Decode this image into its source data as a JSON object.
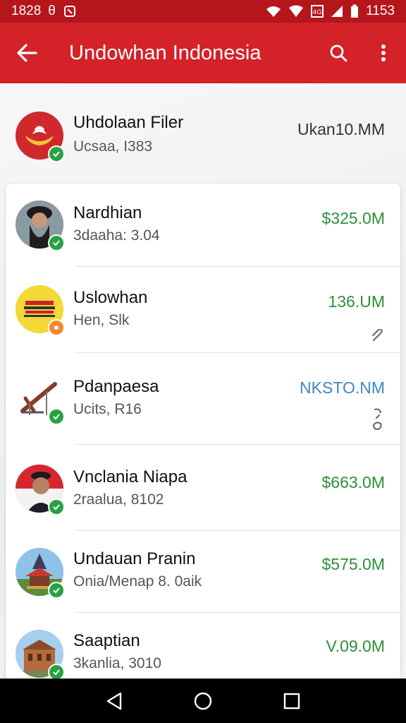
{
  "status_bar": {
    "time_left": "1828",
    "glyph_b": "θ",
    "time_right": "1153"
  },
  "app_bar": {
    "title": "Undowhan Indonesia"
  },
  "header_item": {
    "name": "Uhdolaan Filer",
    "sub": "Ucsaa, I383",
    "amount": "Ukan10.MM"
  },
  "items": [
    {
      "name": "Nardhian",
      "sub": "3daaha: 3.04",
      "amount": "$325.0M",
      "amount_color": "#2d8f3a"
    },
    {
      "name": "Uslowhan",
      "sub": "Hen, Slk",
      "amount": "136.UM",
      "amount_color": "#2d8f3a"
    },
    {
      "name": "Pdanpaesa",
      "sub": "Ucits, R16",
      "amount": "NKSTO.NM",
      "amount_color": "#3e87c4"
    },
    {
      "name": "Vnclania Niapa",
      "sub": "2raalua, 8102",
      "amount": "$663.0M",
      "amount_color": "#2d8f3a"
    },
    {
      "name": "Undauan Pranin",
      "sub": "Onia/Menap 8. 0aik",
      "amount": "$575.0M",
      "amount_color": "#2d8f3a"
    },
    {
      "name": "Saaptian",
      "sub": "3kanlia, 3010",
      "amount": "V.09.0M",
      "amount_color": "#2d8f3a"
    }
  ],
  "icons": {
    "back": "arrow-left-icon",
    "search": "search-icon",
    "more": "more-vert-icon",
    "verified": "check-badge-icon",
    "attach": "paperclip-icon",
    "link": "link-icon"
  },
  "colors": {
    "app_bar": "#d32228",
    "status_bar": "#b5161c",
    "green": "#2d8f3a",
    "blue": "#3e87c4"
  }
}
